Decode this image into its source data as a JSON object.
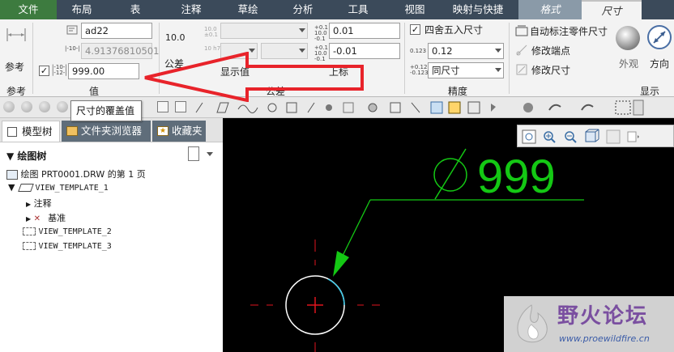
{
  "menubar": {
    "items": [
      {
        "label": "文件"
      },
      {
        "label": "布局"
      },
      {
        "label": "表"
      },
      {
        "label": "注释"
      },
      {
        "label": "草绘"
      },
      {
        "label": "分析"
      },
      {
        "label": "工具"
      },
      {
        "label": "视图"
      },
      {
        "label": "映射与快捷"
      },
      {
        "label": "格式"
      },
      {
        "label": "尺寸"
      }
    ]
  },
  "ribbon": {
    "reference": {
      "button_label": "参考",
      "group_label": "参考"
    },
    "value": {
      "name_value": "ad22",
      "nominal_value": "4.91376810501",
      "override_value": "999.00",
      "group_label": "值",
      "override_checked": "✓"
    },
    "tolerance": {
      "preview_label": "10.0",
      "button_label": "公差",
      "display_value_label": "显示值",
      "group_label": "公差",
      "upper_value": "0.01",
      "lower_value": "-0.01",
      "upper_label": "上标"
    },
    "precision": {
      "round_label": "四舍五入尺寸",
      "round_checked": "✓",
      "decimals_value": "0.12",
      "tol_precision_value": "同尺寸",
      "group_label": "精度"
    },
    "display": {
      "auto_label": "自动标注零件尺寸",
      "modify_ends_label": "修改端点",
      "modify_dim_label": "修改尺寸",
      "appearance_label": "外观",
      "direction_label": "方向",
      "group_label": "显示"
    }
  },
  "tooltip": {
    "text": "尺寸的覆盖值"
  },
  "navigator": {
    "tabs": [
      {
        "label": "模型树"
      },
      {
        "label": "文件夹浏览器"
      },
      {
        "label": "收藏夹"
      }
    ],
    "tree_title": "绘图树",
    "rows": [
      {
        "label": "绘图 PRT0001.DRW 的第 1 页"
      },
      {
        "label": "VIEW_TEMPLATE_1"
      },
      {
        "label": "注释"
      },
      {
        "label": "基准"
      },
      {
        "label": "VIEW_TEMPLATE_2"
      },
      {
        "label": "VIEW_TEMPLATE_3"
      }
    ]
  },
  "canvas": {
    "dimension_text": "999",
    "dimension_color": "#14c814",
    "circle_color": "#ffffff",
    "center_color": "#e0141e"
  },
  "watermark": {
    "title": "野火论坛",
    "url": "www.proewildfire.cn"
  },
  "colors": {
    "menubar": "#3b4a5a",
    "file_tab": "#3d7b3f",
    "arrow": "#e8232a"
  }
}
